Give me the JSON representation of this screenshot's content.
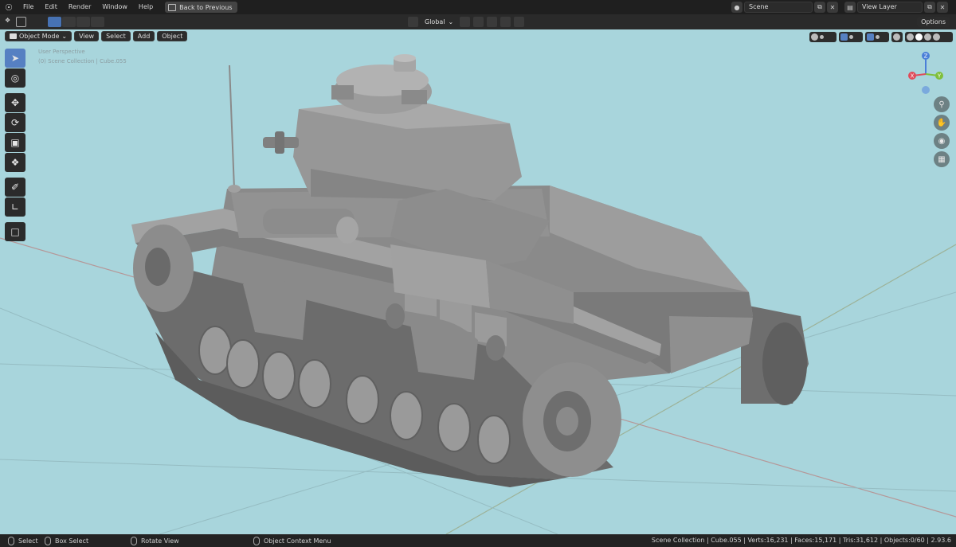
{
  "menu": {
    "items": [
      "File",
      "Edit",
      "Render",
      "Window",
      "Help"
    ],
    "back_button": "Back to Previous",
    "scene": "Scene",
    "view_layer": "View Layer"
  },
  "header": {
    "transform_orientation": "Global",
    "options": "Options",
    "mode": "Object Mode",
    "view": "View",
    "select": "Select",
    "add": "Add",
    "object": "Object"
  },
  "viewport": {
    "perspective_label": "User Perspective",
    "collection_label": "(0) Scene Collection | Cube.055",
    "background_color": "#a8d5dc",
    "gizmo": {
      "x": "X",
      "y": "Y",
      "z": "Z"
    }
  },
  "toolbar": {
    "tools": [
      "select-box-icon",
      "cursor-icon",
      "move-icon",
      "rotate-icon",
      "scale-icon",
      "transform-icon",
      "annotate-icon",
      "measure-icon",
      "add-cube-icon"
    ]
  },
  "statusbar": {
    "select": "Select",
    "box_select": "Box Select",
    "rotate_view": "Rotate View",
    "context_menu": "Object Context Menu",
    "stats": "Scene Collection | Cube.055 | Verts:16,231 | Faces:15,171 | Tris:31,612 | Objects:0/60 | 2.93.6"
  }
}
